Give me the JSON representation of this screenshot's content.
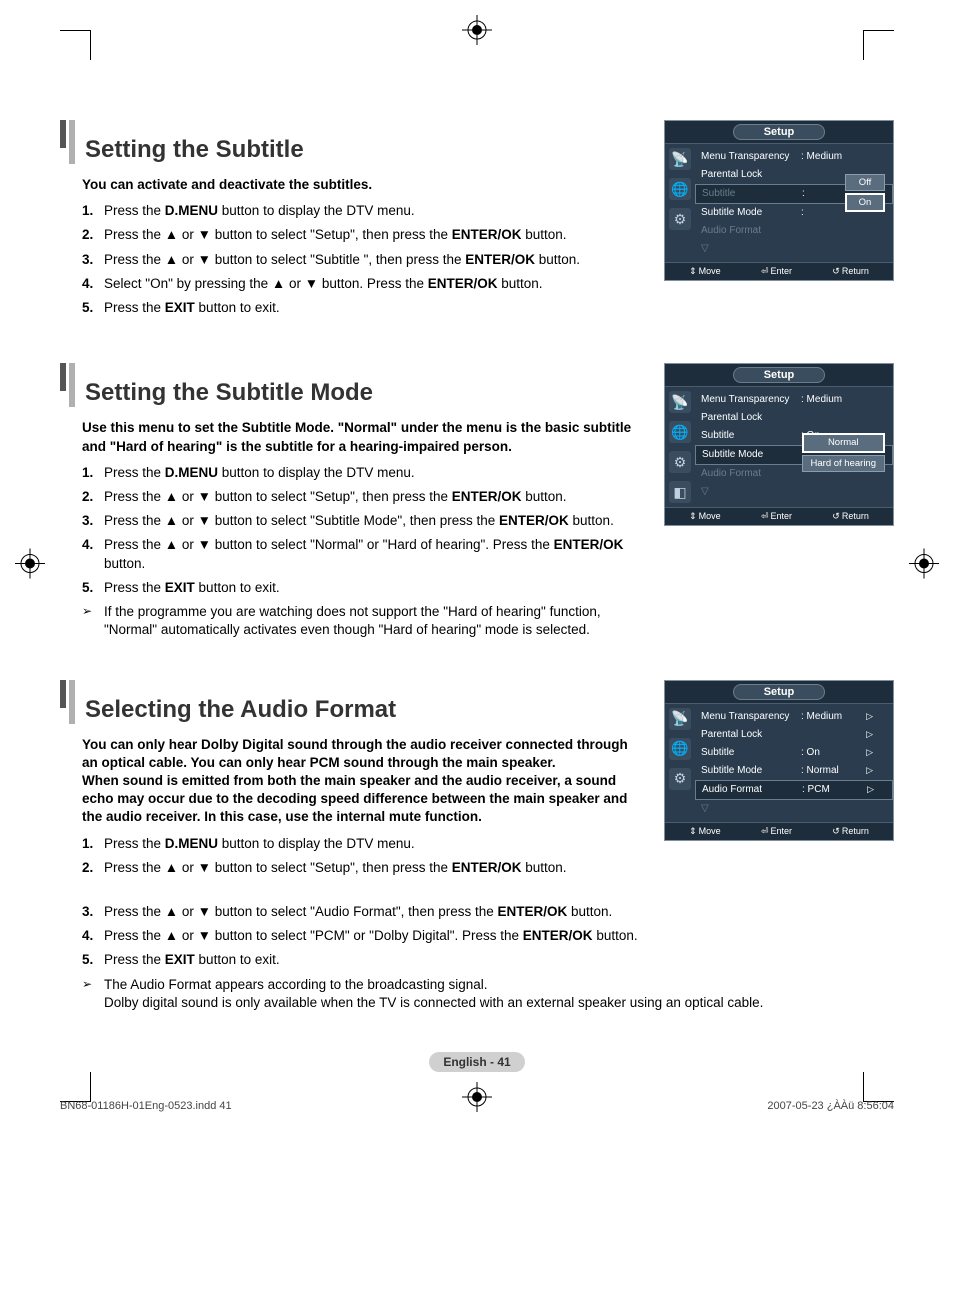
{
  "sections": [
    {
      "title": "Setting the Subtitle",
      "intro": "You can activate and deactivate the subtitles.",
      "steps": [
        "Press the <b>D.MENU</b> button to display the DTV menu.",
        "Press the ▲ or ▼ button to select \"Setup\", then press the <b>ENTER/OK</b> button.",
        "Press the ▲ or ▼ button to select \"Subtitle \", then press the <b>ENTER/OK</b> button.",
        "Select \"On\" by pressing the ▲ or ▼ button. Press the <b>ENTER/OK</b> button.",
        "Press the <b>EXIT</b> button to exit."
      ],
      "notes": []
    },
    {
      "title": "Setting the Subtitle Mode",
      "intro": "Use this menu to set the Subtitle Mode. \"Normal\" under the menu is the basic subtitle and \"Hard of hearing\" is the subtitle for a hearing-impaired person.",
      "steps": [
        "Press the <b>D.MENU</b> button to display the DTV menu.",
        "Press the ▲ or ▼ button to select \"Setup\", then press the <b>ENTER/OK</b> button.",
        "Press the ▲ or ▼ button to select \"Subtitle  Mode\", then press the <b>ENTER/OK</b> button.",
        "Press the ▲ or ▼ button to select \"Normal\" or \"Hard of hearing\". Press the <b>ENTER/OK</b> button.",
        "Press the <b>EXIT</b> button to exit."
      ],
      "notes": [
        "If the programme you are watching does not support the \"Hard of hearing\" function, \"Normal\" automatically activates even though \"Hard of hearing\" mode is selected."
      ]
    },
    {
      "title": "Selecting the Audio Format",
      "intro": "You can only hear Dolby Digital sound through the audio receiver connected through an optical cable. You can only hear PCM sound through the main speaker.<br>When sound is emitted from both the main speaker and the audio receiver, a sound echo may occur due to the decoding speed difference between the main speaker and the audio receiver. In this case, use the internal mute function.",
      "steps_split_first": 2,
      "steps": [
        "Press the <b>D.MENU</b> button to display the DTV menu.",
        "Press the ▲ or ▼ button to select \"Setup\", then press the <b>ENTER/OK</b> button.",
        "Press the ▲ or ▼ button to select \"Audio Format\", then press the <b>ENTER/OK</b> button.",
        "Press the ▲ or ▼ button to select \"PCM\" or \"Dolby Digital\". Press the <b>ENTER/OK</b> button.",
        "Press the <b>EXIT</b> button to exit."
      ],
      "notes": [
        "The Audio Format appears according to the broadcasting signal.<br>Dolby digital sound is only available when the TV is connected with an external speaker using an optical cable."
      ]
    }
  ],
  "osd": {
    "title": "Setup",
    "footer": {
      "move": "Move",
      "enter": "Enter",
      "return": "Return"
    },
    "panel1": {
      "rows": [
        {
          "label": "Menu Transparency",
          "value": ": Medium",
          "cls": ""
        },
        {
          "label": "Parental Lock",
          "value": "",
          "cls": ""
        }
      ],
      "highlight_label": "Subtitle",
      "after_highlight": [
        {
          "label": "Subtitle  Mode",
          "value": ":",
          "cls": ""
        },
        {
          "label": "Audio Format",
          "value": "",
          "cls": "dim"
        }
      ],
      "option_top": "Off",
      "option_sel": "On"
    },
    "panel2": {
      "rows": [
        {
          "label": "Menu Transparency",
          "value": ": Medium",
          "cls": ""
        },
        {
          "label": "Parental Lock",
          "value": "",
          "cls": ""
        },
        {
          "label": "Subtitle",
          "value": ": On",
          "cls": ""
        }
      ],
      "highlight_label": "Subtitle  Mode",
      "after_highlight": [
        {
          "label": "Audio Format",
          "value": "",
          "cls": "dim"
        }
      ],
      "option_top": "Normal",
      "option_bottom": "Hard of hearing"
    },
    "panel3": {
      "rows": [
        {
          "label": "Menu Transparency",
          "value": ": Medium",
          "arrow": "▷"
        },
        {
          "label": "Parental Lock",
          "value": "",
          "arrow": "▷"
        },
        {
          "label": "Subtitle",
          "value": ": On",
          "arrow": "▷"
        },
        {
          "label": "Subtitle  Mode",
          "value": ": Normal",
          "arrow": "▷"
        }
      ],
      "highlight_label": "Audio Format",
      "highlight_value": ": PCM",
      "highlight_arrow": "▷"
    }
  },
  "page_label": "English - 41",
  "footer_left": "BN68-01186H-01Eng-0523.indd   41",
  "footer_right": "2007-05-23   ¿ÀÀü 8:56:04"
}
